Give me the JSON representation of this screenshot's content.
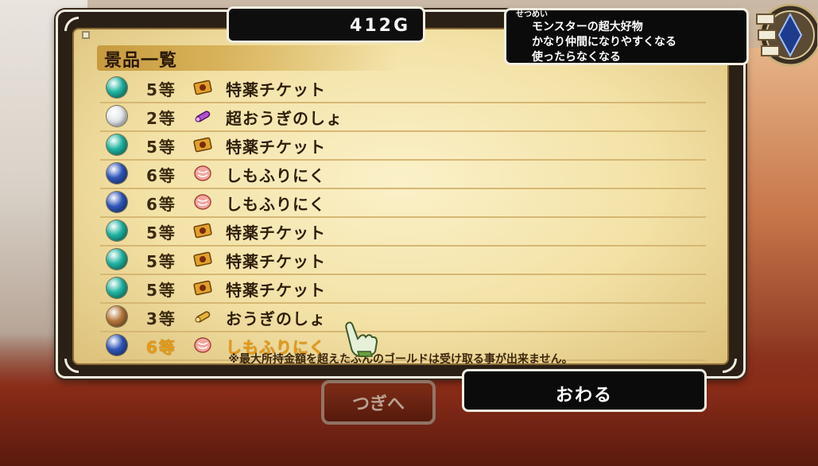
{
  "gold": {
    "value": "412G"
  },
  "description": {
    "label": "せつめい",
    "lines": [
      "モンスターの超大好物",
      "かなり仲間になりやすくなる",
      "使ったらなくなる"
    ]
  },
  "prize_list": {
    "title": "景品一覧",
    "rows": [
      {
        "orb": "teal",
        "grade": "5等",
        "icon": "ticket-icon",
        "name": "特薬チケット",
        "highlighted": false
      },
      {
        "orb": "silver",
        "grade": "2等",
        "icon": "scroll-purple-icon",
        "name": "超おうぎのしょ",
        "highlighted": false
      },
      {
        "orb": "teal",
        "grade": "5等",
        "icon": "ticket-icon",
        "name": "特薬チケット",
        "highlighted": false
      },
      {
        "orb": "blue",
        "grade": "6等",
        "icon": "meat-icon",
        "name": "しもふりにく",
        "highlighted": false
      },
      {
        "orb": "blue",
        "grade": "6等",
        "icon": "meat-icon",
        "name": "しもふりにく",
        "highlighted": false
      },
      {
        "orb": "teal",
        "grade": "5等",
        "icon": "ticket-icon",
        "name": "特薬チケット",
        "highlighted": false
      },
      {
        "orb": "teal",
        "grade": "5等",
        "icon": "ticket-icon",
        "name": "特薬チケット",
        "highlighted": false
      },
      {
        "orb": "teal",
        "grade": "5等",
        "icon": "ticket-icon",
        "name": "特薬チケット",
        "highlighted": false
      },
      {
        "orb": "bronze",
        "grade": "3等",
        "icon": "scroll-gold-icon",
        "name": "おうぎのしょ",
        "highlighted": false
      },
      {
        "orb": "blue",
        "grade": "6等",
        "icon": "meat-icon",
        "name": "しもふりにく",
        "highlighted": true
      }
    ],
    "notice": "※最大所持金額を超えたぶんのゴールドは受け取る事が出来ません。"
  },
  "buttons": {
    "next_label": "つぎへ",
    "end_label": "おわる"
  },
  "colors": {
    "orb_teal": "#1fb3a0",
    "orb_silver": "#e4e8ec",
    "orb_blue": "#2f55b8",
    "orb_bronze": "#b5763a",
    "highlight_text": "#e79a14"
  }
}
